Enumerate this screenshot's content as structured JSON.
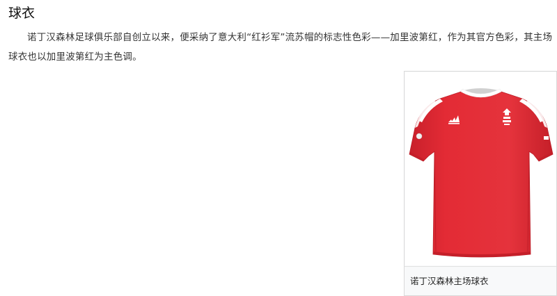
{
  "section": {
    "title": "球衣"
  },
  "paragraph": {
    "text": "诺丁汉森林足球俱乐部自创立以来，便采纳了意大利“红衫军”流苏帽的标志性色彩——加里波第红，作为其官方色彩，其主场球衣也以加里波第红为主色调。"
  },
  "figure": {
    "image_icon": "red-jersey-image",
    "jersey_color": "#e32b35",
    "trim_color": "#ffffff",
    "caption": "诺丁汉森林主场球衣"
  }
}
